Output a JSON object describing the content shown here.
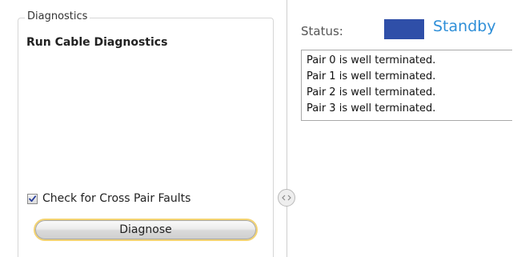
{
  "diagnostics": {
    "group_title": "Diagnostics",
    "section_title": "Run Cable Diagnostics",
    "cross_pair": {
      "label": "Check for Cross Pair Faults",
      "checked": true
    },
    "diagnose_button_label": "Diagnose"
  },
  "splitter": {
    "icon": "collapse-expand-icon"
  },
  "status": {
    "label": "Status:",
    "value": "Standby",
    "swatch_color": "#2f4fa8",
    "value_color": "#2f8fd8"
  },
  "results": {
    "lines": [
      "Pair 0 is well terminated.",
      "Pair 1 is well terminated.",
      "Pair 2 is well terminated.",
      "Pair 3 is well terminated."
    ]
  },
  "colors": {
    "button_border": "#f3d372",
    "panel_border": "#d6d6d6"
  }
}
